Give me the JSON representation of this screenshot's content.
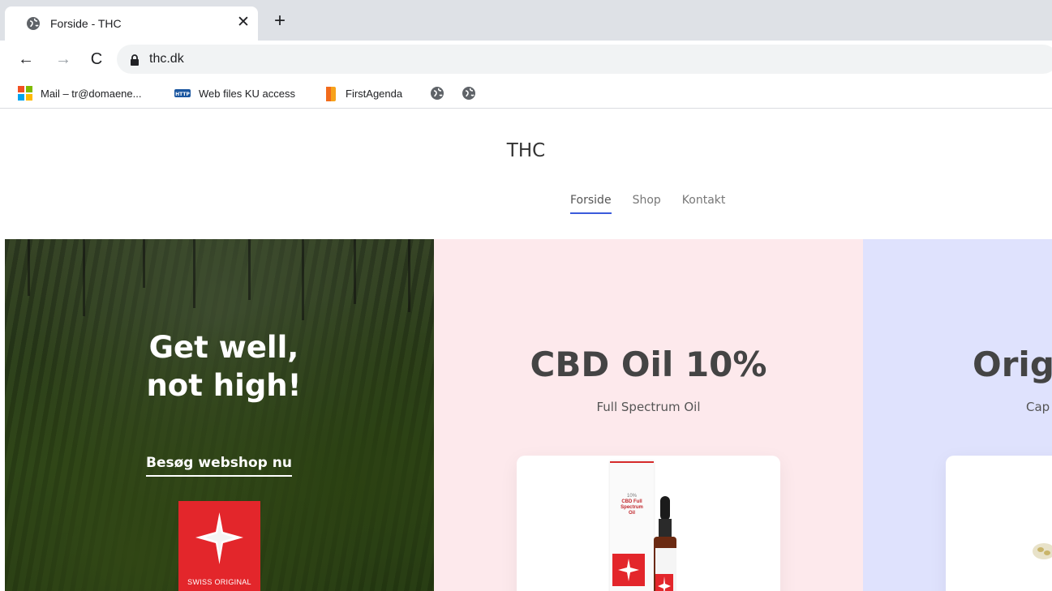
{
  "browser": {
    "tab": {
      "title": "Forside - THC",
      "close_label": "✕"
    },
    "new_tab_label": "+",
    "nav": {
      "back": "←",
      "forward": "→",
      "reload": "C"
    },
    "url": "thc.dk",
    "bookmarks": [
      {
        "label": "Mail – tr@domaene...",
        "icon": "microsoft-icon"
      },
      {
        "label": "Web files KU access",
        "icon": "http-icon"
      },
      {
        "label": "FirstAgenda",
        "icon": "firstagenda-icon"
      }
    ]
  },
  "site": {
    "title": "THC",
    "nav": [
      {
        "label": "Forside",
        "active": true
      },
      {
        "label": "Shop",
        "active": false
      },
      {
        "label": "Kontakt",
        "active": false
      }
    ],
    "hero": {
      "heading_line1": "Get well,",
      "heading_line2": "not high!",
      "cta": "Besøg webshop nu",
      "logo_text": "SWISS ORIGINAL"
    },
    "products": [
      {
        "title": "CBD Oil 10%",
        "subtitle": "Full Spectrum Oil",
        "box_text_1": "10%",
        "box_text_2": "CBD Full",
        "box_text_3": "Spectrum",
        "box_text_4": "Oil"
      },
      {
        "title": "Origi",
        "subtitle": "Cap"
      }
    ]
  },
  "colors": {
    "accent": "#3b5bdb",
    "panel_pink": "#fde9ec",
    "panel_lavender": "#dfe2fd",
    "brand_red": "#e3262b"
  }
}
